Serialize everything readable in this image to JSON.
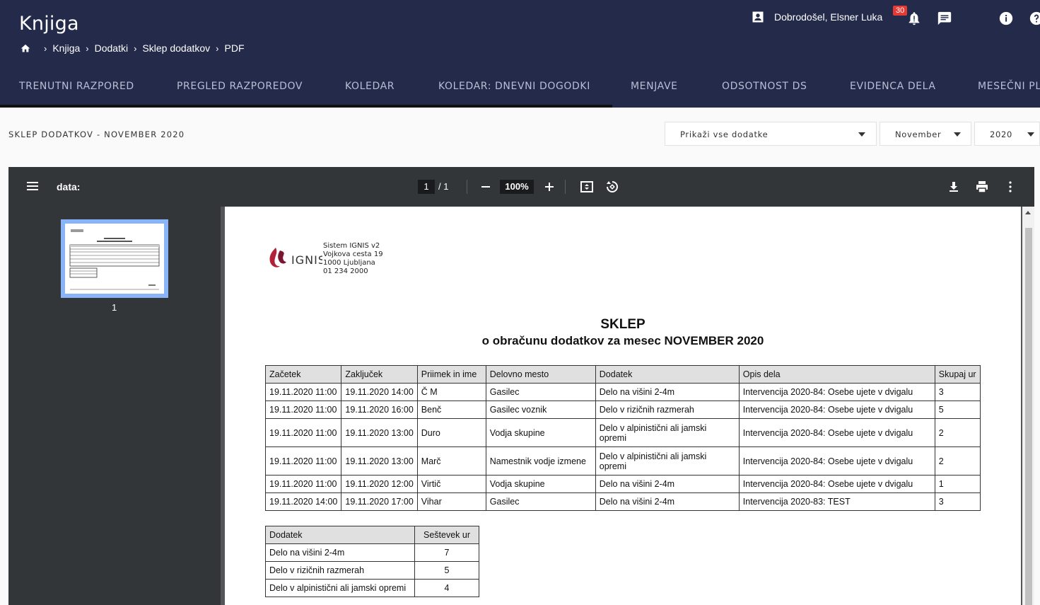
{
  "header": {
    "app_title": "Knjiga",
    "breadcrumbs": [
      "Knjiga",
      "Dodatki",
      "Sklep dodatkov",
      "PDF"
    ],
    "user_greeting": "Dobrodošel, Elsner Luka",
    "notification_count": "30"
  },
  "tabs": [
    "TRENUTNI RAZPORED",
    "PREGLED RAZPOREDOV",
    "KOLEDAR",
    "KOLEDAR: DNEVNI DOGODKI",
    "MENJAVE",
    "ODSOTNOST DS",
    "EVIDENCA DELA",
    "MESEČNI PL"
  ],
  "page": {
    "heading": "SKLEP DODATKOV - NOVEMBER 2020",
    "filter_select": "Prikaži vse dodatke",
    "month_select": "November",
    "year_select": "2020"
  },
  "viewer": {
    "doc_name": "data:",
    "page_current": "1",
    "page_total": "/ 1",
    "zoom": "100%",
    "thumb_label": "1"
  },
  "document": {
    "org_lines": [
      "Sistem IGNIS v2",
      "Vojkova cesta 19",
      "1000 Ljubljana",
      "01 234 2000"
    ],
    "logo_text": "IGNIS",
    "title": "SKLEP",
    "subtitle": "o obračunu dodatkov za mesec NOVEMBER 2020",
    "table_headers": [
      "Začetek",
      "Zaključek",
      "Priimek in ime",
      "Delovno mesto",
      "Dodatek",
      "Opis dela",
      "Skupaj ur"
    ],
    "rows": [
      [
        "19.11.2020 11:00",
        "19.11.2020 14:00",
        "Č M",
        "Gasilec",
        "Delo na višini 2-4m",
        "Intervencija 2020-84: Osebe ujete v dvigalu",
        "3"
      ],
      [
        "19.11.2020 11:00",
        "19.11.2020 16:00",
        "Benč",
        "Gasilec voznik",
        "Delo v rizičnih razmerah",
        "Intervencija 2020-84: Osebe ujete v dvigalu",
        "5"
      ],
      [
        "19.11.2020 11:00",
        "19.11.2020 13:00",
        "Duro",
        "Vodja skupine",
        "Delo v alpinistični ali jamski opremi",
        "Intervencija 2020-84: Osebe ujete v dvigalu",
        "2"
      ],
      [
        "19.11.2020 11:00",
        "19.11.2020 13:00",
        "Marč",
        "Namestnik vodje izmene",
        "Delo v alpinistični ali jamski opremi",
        "Intervencija 2020-84: Osebe ujete v dvigalu",
        "2"
      ],
      [
        "19.11.2020 11:00",
        "19.11.2020 12:00",
        "Virtič",
        "Vodja skupine",
        "Delo na višini 2-4m",
        "Intervencija 2020-84: Osebe ujete v dvigalu",
        "1"
      ],
      [
        "19.11.2020 14:00",
        "19.11.2020 17:00",
        "Vihar",
        "Gasilec",
        "Delo na višini 2-4m",
        "Intervencija 2020-83: TEST",
        "3"
      ]
    ],
    "summary_headers": [
      "Dodatek",
      "Seštevek ur"
    ],
    "summary_rows": [
      [
        "Delo na višini 2-4m",
        "7"
      ],
      [
        "Delo v rizičnih razmerah",
        "5"
      ],
      [
        "Delo v alpinistični ali jamski opremi",
        "4"
      ]
    ]
  },
  "colors": {
    "header_bg": "#232a4a",
    "viewer_toolbar": "#323639",
    "viewer_bg": "#525659",
    "badge": "#e53935",
    "thumb_highlight": "#8ab4f8",
    "logo_red": "#b3203a"
  },
  "icons": [
    "home-icon",
    "account-icon",
    "bell-icon",
    "chat-icon",
    "moon-icon",
    "info-icon",
    "help-icon",
    "menu-icon",
    "fit-page-icon",
    "rotate-icon",
    "download-icon",
    "print-icon",
    "more-icon"
  ]
}
